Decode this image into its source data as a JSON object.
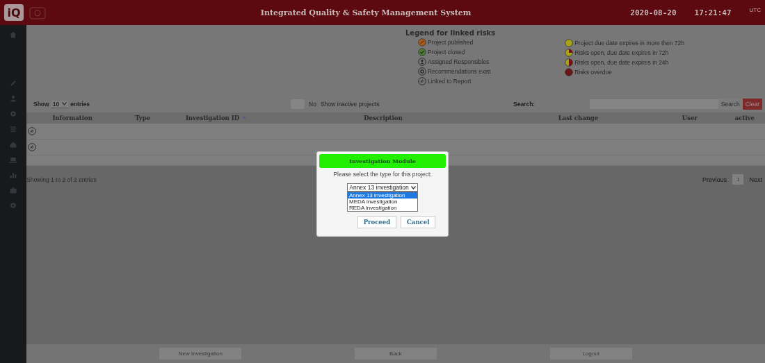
{
  "header": {
    "logo": "iQ",
    "title": "Integrated Quality & Safety Management System",
    "date": "2020-08-20",
    "time": "17:21:47",
    "timezone": "UTC"
  },
  "legend": {
    "title": "Legend for linked risks",
    "left": [
      {
        "kind": "published",
        "label": "Project published"
      },
      {
        "kind": "closed",
        "label": "Project closed"
      },
      {
        "kind": "assigned",
        "label": "Assigned Responsibles"
      },
      {
        "kind": "recommendations",
        "label": "Recommendations exist"
      },
      {
        "kind": "linked",
        "label": "Linked to Report"
      }
    ],
    "right": [
      {
        "kind": "due-72-plus",
        "label": "Project due date expires in more then 72h"
      },
      {
        "kind": "due-72",
        "label": "Risks open, due date expires in 72h"
      },
      {
        "kind": "due-24",
        "label": "Risks open, due date expires in 24h"
      },
      {
        "kind": "overdue",
        "label": "Risks overdue"
      }
    ]
  },
  "controls": {
    "show_label": "Show",
    "page_size": "10",
    "entries_label": "entries",
    "toggle_on": false,
    "toggle_value": "No",
    "toggle_label": "Show inactive projects",
    "search_label": "Search:",
    "search_button": "Search",
    "clear_button": "Clear"
  },
  "table": {
    "columns": [
      {
        "label": "Information",
        "sorted": false
      },
      {
        "label": "Type",
        "sorted": false
      },
      {
        "label": "Investigation ID",
        "sorted": true
      },
      {
        "label": "Description",
        "sorted": false
      },
      {
        "label": "Last change",
        "sorted": false
      },
      {
        "label": "User",
        "sorted": false
      },
      {
        "label": "active",
        "sorted": false
      }
    ],
    "rows": [
      {
        "kind": "linked"
      },
      {
        "kind": "linked"
      }
    ]
  },
  "info": "Showing 1 to 2 of 2 entries",
  "pagination": {
    "previous": "Previous",
    "pages": [
      {
        "label": "1",
        "selected": true
      }
    ],
    "next": "Next"
  },
  "modal": {
    "title": "Investigation Module",
    "prompt": "Please select the type for this project:",
    "select_value": "Annex 13 investigation",
    "options": [
      {
        "label": "Annex 13 investigation",
        "selected": true
      },
      {
        "label": "MEDA investigation",
        "selected": false
      },
      {
        "label": "REDA investigation",
        "selected": false
      }
    ],
    "buttons": [
      "Proceed",
      "Cancel"
    ]
  },
  "footer_buttons": [
    "New Investigation",
    "Back",
    "Logout"
  ]
}
